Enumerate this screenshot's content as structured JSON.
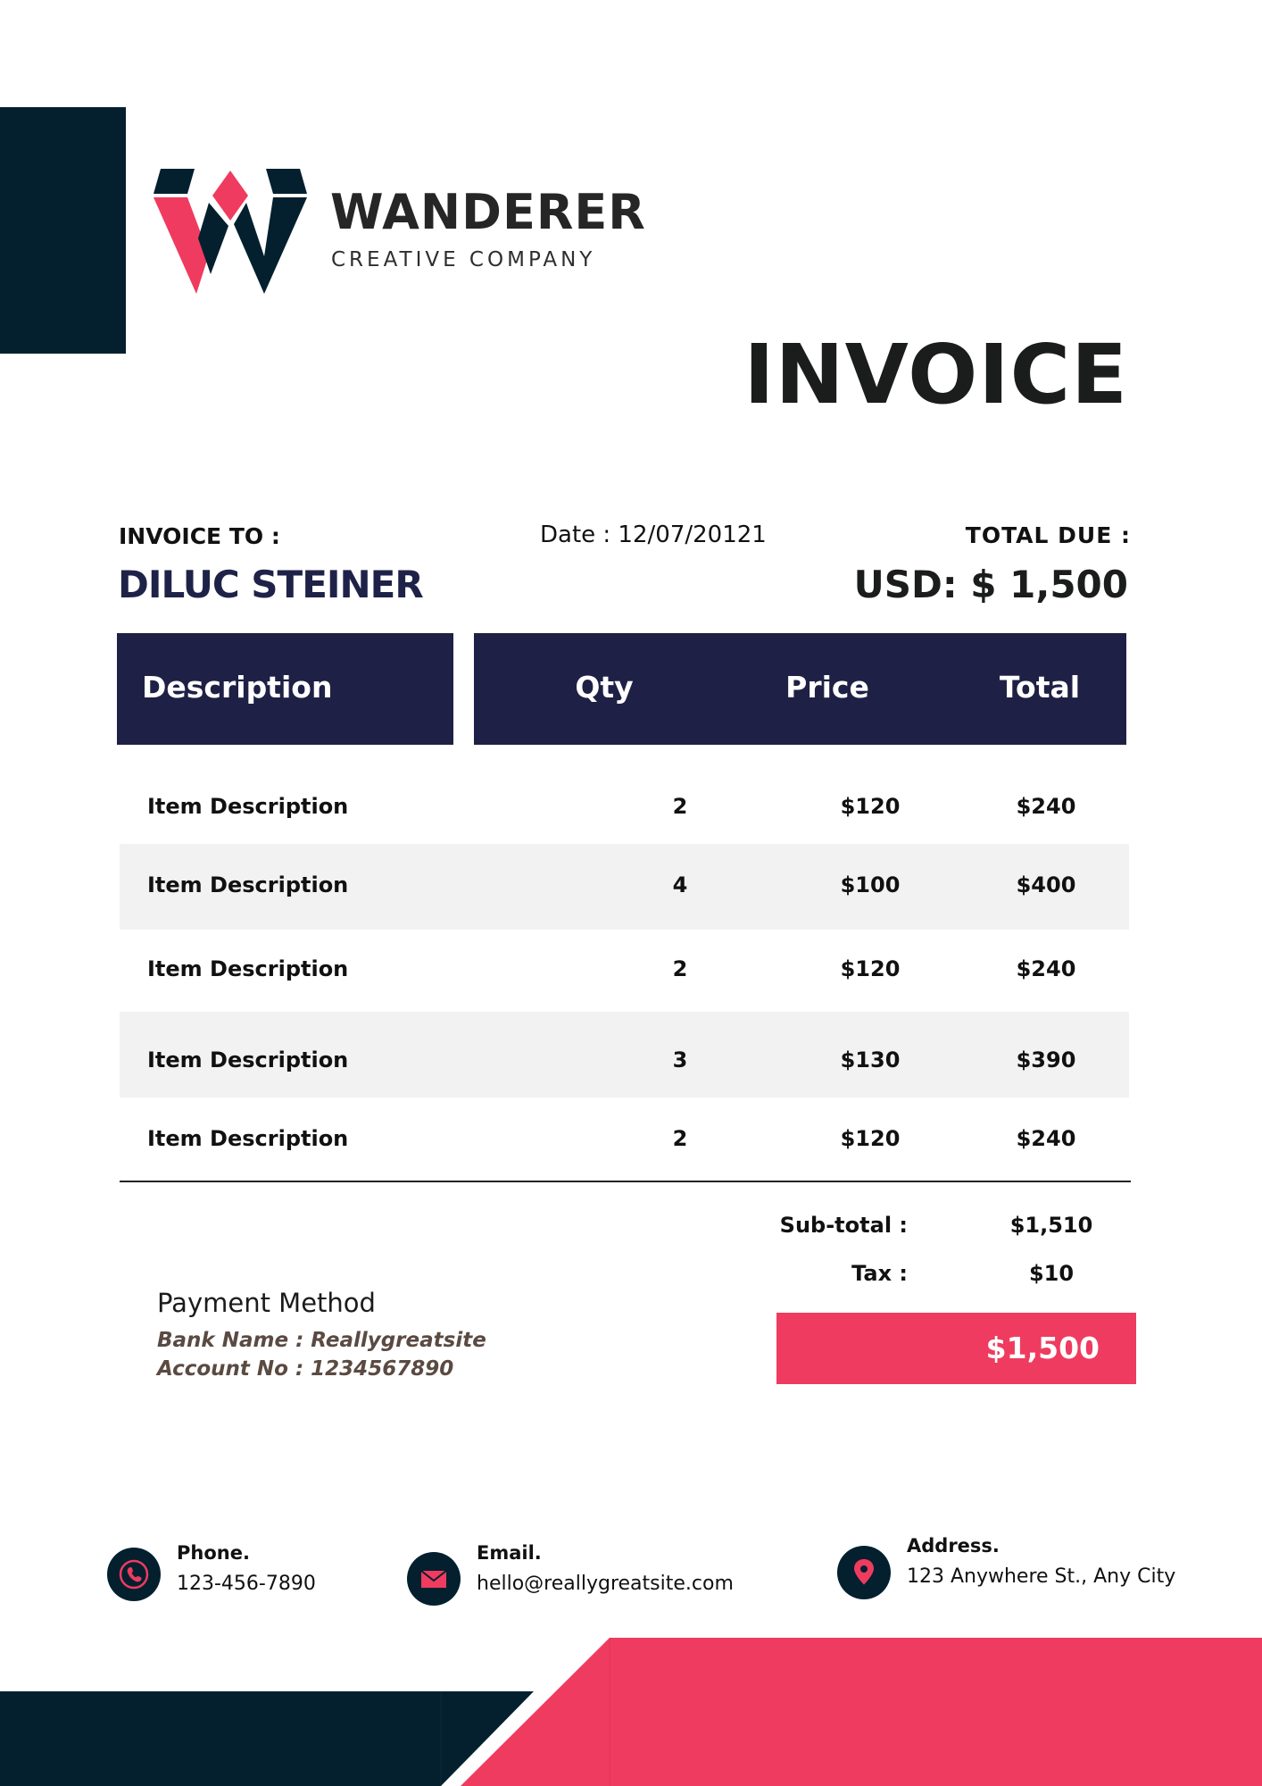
{
  "brand": {
    "name": "WANDERER",
    "tagline": "CREATIVE COMPANY"
  },
  "document_title": "INVOICE",
  "billing": {
    "invoice_to_label": "INVOICE TO :",
    "client_name": "DILUC STEINER",
    "date_line": "Date : 12/07/20121",
    "total_due_label": "TOTAL DUE :",
    "total_due_amount": "USD: $ 1,500"
  },
  "table": {
    "headers": [
      "Description",
      "Qty",
      "Price",
      "Total"
    ],
    "rows": [
      {
        "description": "Item Description",
        "qty": "2",
        "price": "$120",
        "total": "$240"
      },
      {
        "description": "Item Description",
        "qty": "4",
        "price": "$100",
        "total": "$400"
      },
      {
        "description": "Item Description",
        "qty": "2",
        "price": "$120",
        "total": "$240"
      },
      {
        "description": "Item Description",
        "qty": "3",
        "price": "$130",
        "total": "$390"
      },
      {
        "description": "Item Description",
        "qty": "2",
        "price": "$120",
        "total": "$240"
      }
    ]
  },
  "totals": {
    "subtotal_label": "Sub-total :",
    "subtotal_value": "$1,510",
    "tax_label": "Tax :",
    "tax_value": "$10",
    "grand_total": "$1,500"
  },
  "payment": {
    "title": "Payment Method",
    "bank_line": "Bank Name : Reallygreatsite",
    "account_line": "Account No : 1234567890"
  },
  "contacts": {
    "phone_label": "Phone.",
    "phone_value": "123-456-7890",
    "email_label": "Email.",
    "email_value": "hello@reallygreatsite.com",
    "address_label": "Address.",
    "address_value": "123 Anywhere St., Any City",
    "icons": [
      "phone-icon",
      "email-icon",
      "location-pin-icon"
    ]
  },
  "colors": {
    "navy": "#04202f",
    "header_navy": "#1f2045",
    "accent_pink": "#ef3b5f",
    "row_shade": "#f2f2f2"
  }
}
